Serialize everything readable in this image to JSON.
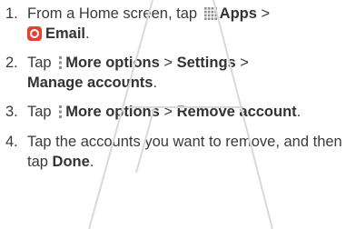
{
  "steps": [
    {
      "number": "1.",
      "parts": {
        "a": "From a Home screen, tap",
        "b_apps": "Apps",
        "c": ">",
        "d_email": "Email",
        "e": "."
      }
    },
    {
      "number": "2.",
      "parts": {
        "a": "Tap",
        "b_more": "More options",
        "c": ">",
        "d_settings": "Settings",
        "e": ">",
        "f_manage": "Manage accounts",
        "g": "."
      }
    },
    {
      "number": "3.",
      "parts": {
        "a": "Tap",
        "b_more": "More options",
        "c": ">",
        "d_remove": "Remove account",
        "e": "."
      }
    },
    {
      "number": "4.",
      "parts": {
        "a": "Tap the accounts you want to remove, and then tap",
        "b_done": "Done",
        "c": "."
      }
    }
  ],
  "icons": {
    "apps": "apps-grid-icon",
    "email": "email-app-icon",
    "more": "more-options-icon"
  },
  "colors": {
    "text": "#3a3a3a",
    "email_icon": "#e2422f",
    "watermark": "#d9d9d9"
  }
}
